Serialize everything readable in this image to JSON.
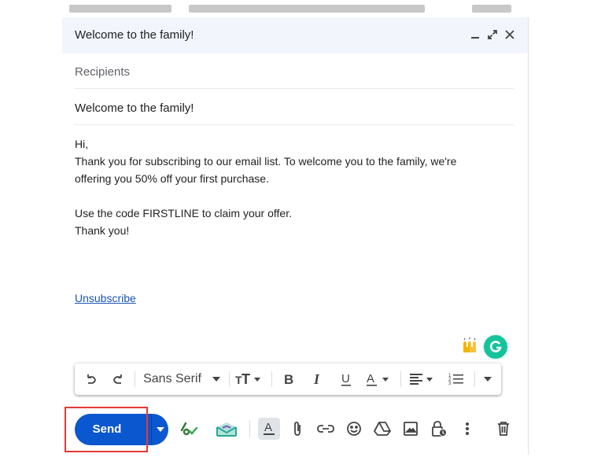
{
  "compose": {
    "title": "Welcome to the family!",
    "header_icons": [
      "minimize-icon",
      "expand-icon",
      "close-icon"
    ],
    "recipients_placeholder": "Recipients",
    "subject": "Welcome to the family!",
    "body_lines": [
      "Hi,",
      "Thank you for subscribing to our email list. To welcome you to the family, we're",
      "offering you 50% off your first purchase.",
      "",
      "Use the code FIRSTLINE to claim your offer.",
      "Thank you!"
    ],
    "unsubscribe_link": "Unsubscribe"
  },
  "formatting_toolbar": {
    "font": "Sans Serif",
    "icons": [
      "undo-icon",
      "redo-icon",
      "font-size-icon",
      "bold-icon",
      "italic-icon",
      "underline-icon",
      "text-color-icon",
      "align-icon",
      "numbered-list-icon",
      "more-formatting-icon"
    ]
  },
  "bottom_bar": {
    "send_label": "Send",
    "icons": [
      "schedule-send-check-icon",
      "mailmeteor-icon",
      "formatting-options-icon",
      "attach-icon",
      "link-icon",
      "emoji-icon",
      "drive-icon",
      "photo-icon",
      "confidential-mode-icon",
      "more-options-icon",
      "discard-icon"
    ]
  },
  "colors": {
    "header_bg": "#f2f6fc",
    "send_bg": "#0b57d0",
    "link": "#1a55b6",
    "highlight": "#e53935",
    "grammarly": "#15c39a"
  }
}
